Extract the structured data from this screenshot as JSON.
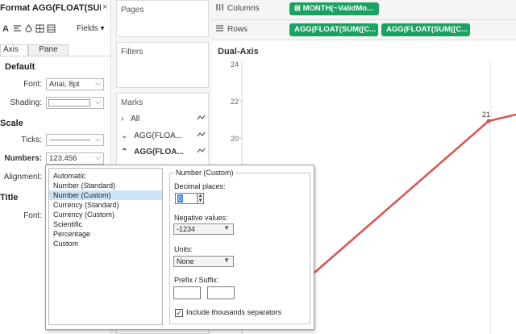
{
  "format_pane": {
    "title": "Format AGG(FLOAT(SUM...",
    "close": "×",
    "toolbar": {
      "font_icon": "A",
      "fields_label": "Fields ▾"
    },
    "tabs": {
      "axis": "Axis",
      "pane": "Pane"
    },
    "default": {
      "heading": "Default",
      "font_label": "Font:",
      "font_value": "Arial, 8pt",
      "shading_label": "Shading:"
    },
    "scale": {
      "heading": "Scale",
      "ticks_label": "Ticks:",
      "numbers_label": "Numbers:",
      "numbers_value": "123,456",
      "alignment_label": "Alignment:"
    },
    "title_section": {
      "heading": "Title",
      "font_label": "Font:"
    }
  },
  "shelves": {
    "pages": "Pages",
    "filters": "Filters",
    "marks": "Marks",
    "mark_rows": [
      {
        "label": "All"
      },
      {
        "label": "AGG(FLOA..."
      },
      {
        "label": "AGG(FLOA..."
      }
    ],
    "columns_label": "Columns",
    "rows_label": "Rows",
    "columns_pill": "⊞ MONTH(~ValidMo...",
    "rows_pills": [
      "AGG(FLOAT(SUM([C...",
      "AGG(FLOAT(SUM([C..."
    ]
  },
  "chart": {
    "title": "Dual-Axis",
    "y_ticks": [
      "24",
      "22",
      "20"
    ],
    "data_label": "21",
    "line_color": "#d9534f"
  },
  "popup": {
    "formats": [
      "Automatic",
      "Number (Standard)",
      "Number (Custom)",
      "Currency (Standard)",
      "Currency (Custom)",
      "Scientific",
      "Percentage",
      "Custom"
    ],
    "selected_format": "Number (Custom)",
    "group_title": "Number (Custom)",
    "decimal_label": "Decimal places:",
    "decimal_value": "0",
    "negative_label": "Negative values:",
    "negative_value": "-1234",
    "units_label": "Units:",
    "units_value": "None",
    "prefix_label": "Prefix / Suffix:",
    "thousands_label": "Include thousands separators",
    "thousands_checked": true
  },
  "colors": {
    "pill_green": "#1aa260",
    "selection_blue": "#cce4f7",
    "line_red": "#d9534f"
  }
}
